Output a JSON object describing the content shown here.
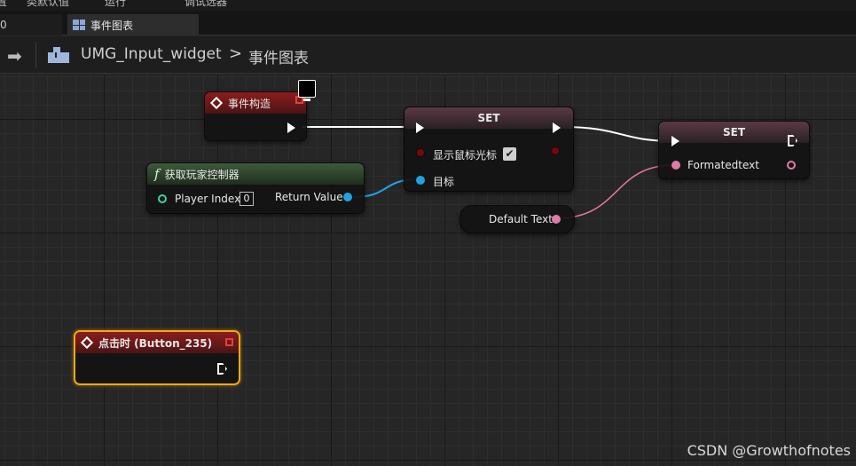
{
  "menubar": {
    "items": [
      "置",
      "类默认值",
      "运行",
      "调试选器"
    ]
  },
  "tabs": [
    {
      "label": "0",
      "active": false
    },
    {
      "label": "事件图表",
      "active": true
    }
  ],
  "breadcrumb": {
    "blueprint": "UMG_Input_widget",
    "separator": ">",
    "graph": "事件图表"
  },
  "nodes": {
    "construct": {
      "title": "事件构造"
    },
    "get_controller": {
      "title": "获取玩家控制器",
      "player_index_label": "Player Index",
      "player_index_value": "0",
      "return_label": "Return Value"
    },
    "set1": {
      "title": "SET",
      "show_cursor_label": "显示鼠标光标",
      "target_label": "目标",
      "show_cursor_checked": "✔"
    },
    "default_text": {
      "label": "Default Text"
    },
    "set2": {
      "title": "SET",
      "formatted_label": "Formatedtext"
    },
    "on_clicked": {
      "title": "点击时 (Button_235)"
    }
  },
  "watermark": "CSDN @Growthofnotes",
  "colors": {
    "exec": "#ffffff",
    "object_pin": "#1fa3e0",
    "text_pin": "#e07aa6",
    "bool_pin": "#6b0d0d",
    "int_pin": "#3fd29c",
    "selection": "#f0a818"
  }
}
